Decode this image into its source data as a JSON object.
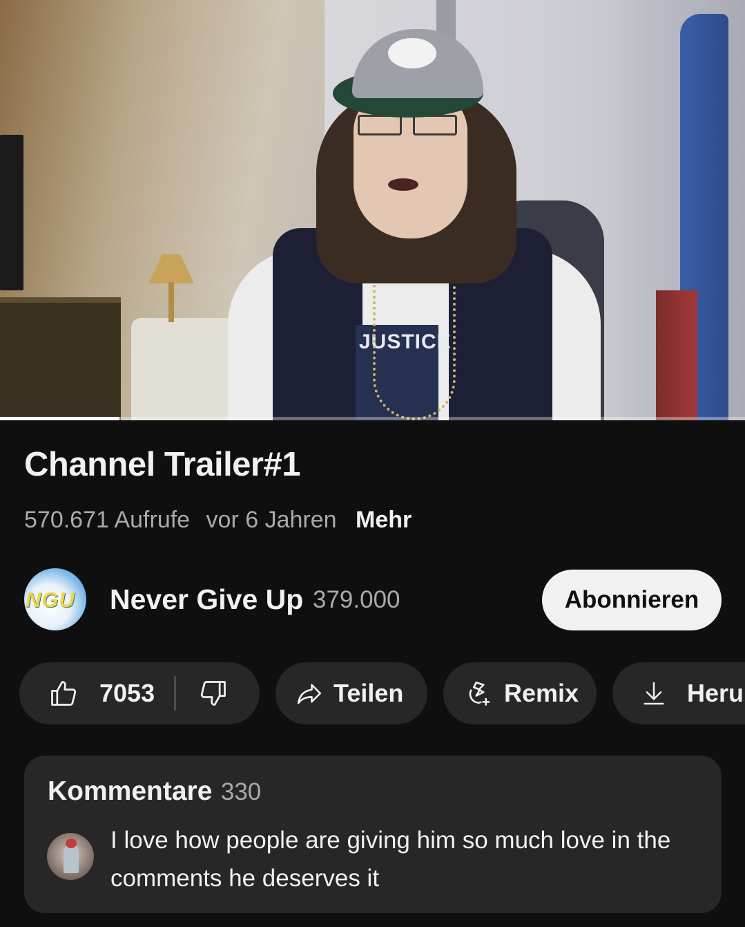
{
  "video": {
    "progress_percent": 16,
    "shirt_print": "JUSTICE"
  },
  "info": {
    "title": "Channel Trailer#1",
    "views": "570.671 Aufrufe",
    "age": "vor 6 Jahren",
    "more_label": "Mehr"
  },
  "channel": {
    "avatar_text": "NGU",
    "name": "Never Give Up",
    "subscribers": "379.000",
    "subscribe_label": "Abonnieren"
  },
  "actions": {
    "like_count": "7053",
    "share_label": "Teilen",
    "remix_label": "Remix",
    "download_label": "Herunterladen"
  },
  "comments": {
    "title": "Kommentare",
    "count": "330",
    "top_comment": "I love how people are giving him so much love in the comments he deserves it"
  },
  "colors": {
    "background": "#0f0f0f",
    "pill": "#272727",
    "primary_text": "#f1f1f1",
    "secondary_text": "#aaaaaa",
    "subscribe_bg": "#f1f1f1"
  },
  "icons": [
    "thumbs-up-icon",
    "thumbs-down-icon",
    "share-arrow-icon",
    "remix-icon",
    "download-icon"
  ]
}
